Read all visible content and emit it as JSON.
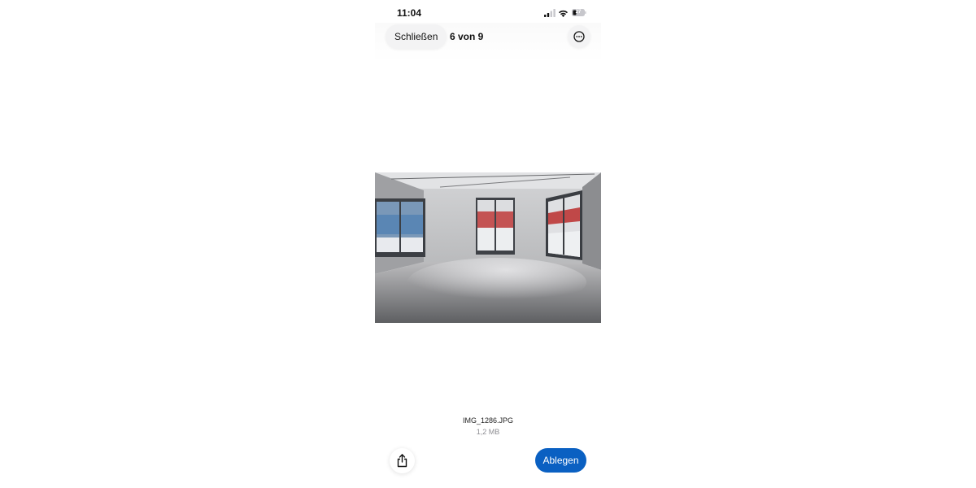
{
  "status_bar": {
    "time": "11:04",
    "battery": "27",
    "icons": [
      "cellular-signal-icon",
      "wifi-icon",
      "battery-icon"
    ]
  },
  "top_bar": {
    "close_label": "Schließen",
    "counter": "6 von 9",
    "more_icon": "ellipsis-circle-icon"
  },
  "photo": {
    "description_icon": "photo-image"
  },
  "file": {
    "name": "IMG_1286.JPG",
    "size": "1,2 MB"
  },
  "bottom_bar": {
    "share_icon": "share-icon",
    "save_label": "Ablegen"
  },
  "colors": {
    "accent": "#0a60c2",
    "secondary_text": "#8e8e93"
  }
}
